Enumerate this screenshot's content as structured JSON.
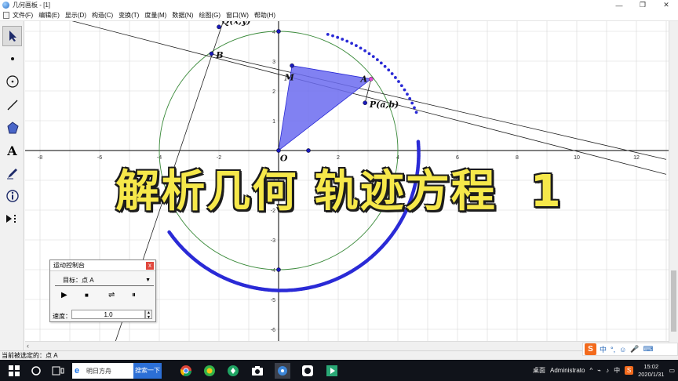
{
  "window": {
    "title": "几何画板 - [1]",
    "min": "—",
    "restore": "❐",
    "close": "✕"
  },
  "menu": [
    "文件(F)",
    "编辑(E)",
    "显示(D)",
    "构造(C)",
    "变换(T)",
    "度量(M)",
    "数据(N)",
    "绘图(G)",
    "窗口(W)",
    "帮助(H)"
  ],
  "tools": [
    {
      "name": "arrow-select-tool-icon"
    },
    {
      "name": "point-tool-icon"
    },
    {
      "name": "compass-tool-icon"
    },
    {
      "name": "straightedge-tool-icon"
    },
    {
      "name": "polygon-tool-icon"
    },
    {
      "name": "text-tool-icon",
      "glyph": "A"
    },
    {
      "name": "marker-tool-icon"
    },
    {
      "name": "information-tool-icon"
    },
    {
      "name": "custom-tool-icon"
    }
  ],
  "graph": {
    "x_ticks": [
      "-8",
      "-6",
      "-4",
      "-2",
      "2",
      "4",
      "6",
      "8",
      "10",
      "12"
    ],
    "y_ticks": [
      "4",
      "3",
      "2",
      "1",
      "-1",
      "-2",
      "-3",
      "-4",
      "-5",
      "-6"
    ],
    "labels": {
      "Q": "Q(x,y)",
      "B": "B",
      "M": "M",
      "A": "A",
      "P": "P(a,b)",
      "O": "O"
    },
    "colors": {
      "triangle": "#6b6bf0",
      "locus": "#2a2ad6",
      "circle": "#3a8a3a",
      "axis": "#000000",
      "grid": "#d7d7d7"
    }
  },
  "overlay_title": "解析几何 轨迹方程  1",
  "motion_panel": {
    "title": "运动控制台",
    "close": "x",
    "target": "目标：点 A",
    "controls": {
      "play": "▶",
      "stop": "■",
      "reverse": "⇌",
      "pause": "⏸"
    },
    "speed_label": "速度：",
    "speed_value": "1.0"
  },
  "status": "当前被选定的：点 A",
  "ime": {
    "logo": "S",
    "lang": "中"
  },
  "taskbar": {
    "search_text": "明日方舟",
    "search_button": "搜索一下",
    "desktop": "桌面",
    "user": "Administrato",
    "ime_lang": "中",
    "time": "15:02",
    "date": "2020/1/31"
  }
}
